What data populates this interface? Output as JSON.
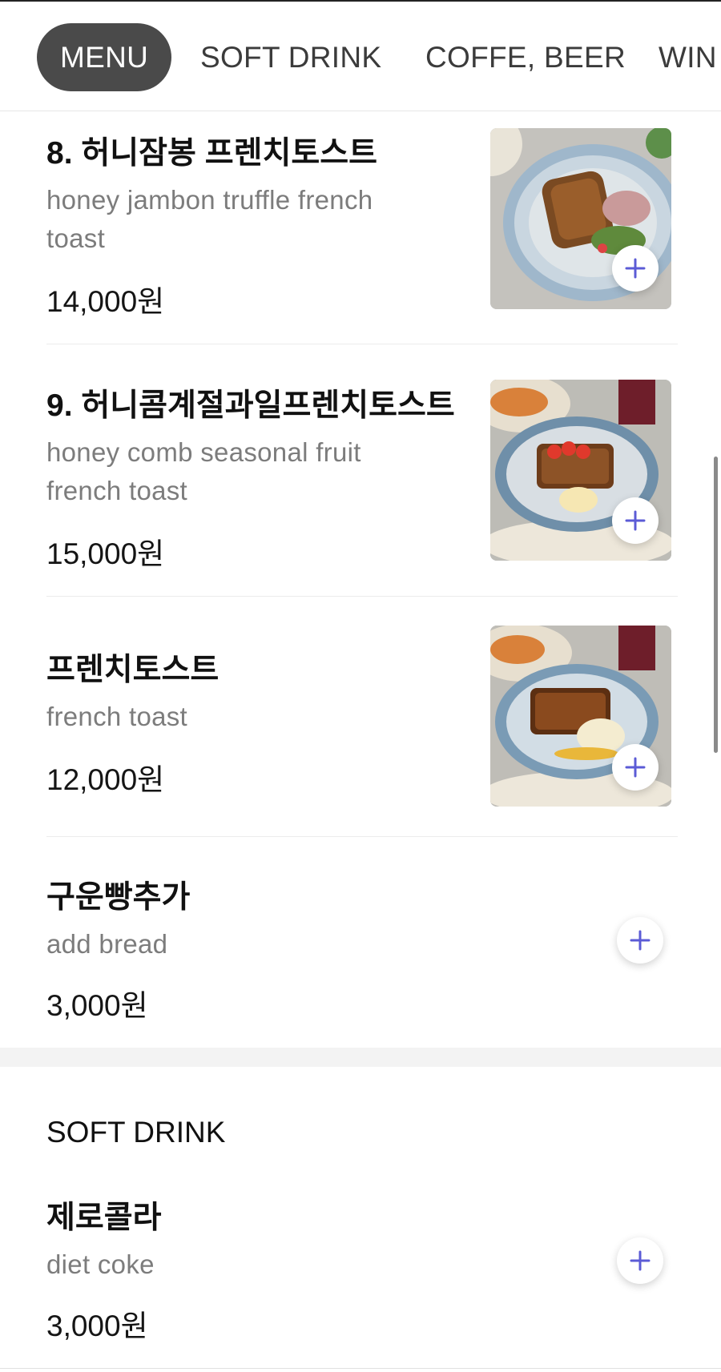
{
  "tabs": [
    {
      "label": "MENU",
      "active": true
    },
    {
      "label": "SOFT DRINK",
      "active": false
    },
    {
      "label": "COFFE, BEER",
      "active": false
    },
    {
      "label": "WIN",
      "active": false
    }
  ],
  "items": [
    {
      "name": "8. 허니잠봉 프렌치토스트",
      "desc": "honey jambon truffle french toast",
      "price": "14,000원",
      "image": "french-toast-with-jambon-photo"
    },
    {
      "name": "9. 허니콤계절과일프렌치토스트",
      "desc": "honey comb seasonal fruit french toast",
      "price": "15,000원",
      "image": "french-toast-with-fruit-photo"
    },
    {
      "name": "프렌치토스트",
      "desc": "french toast",
      "price": "12,000원",
      "image": "french-toast-with-ice-cream-photo"
    },
    {
      "name": "구운빵추가",
      "desc": "add bread",
      "price": "3,000원"
    }
  ],
  "soft_drink": {
    "title": "SOFT DRINK",
    "items": [
      {
        "name": "제로콜라",
        "desc": "diet coke",
        "price": "3,000원"
      }
    ]
  },
  "colors": {
    "active_tab_bg": "#4a4a4a",
    "plus_icon": "#5b5bd6"
  }
}
